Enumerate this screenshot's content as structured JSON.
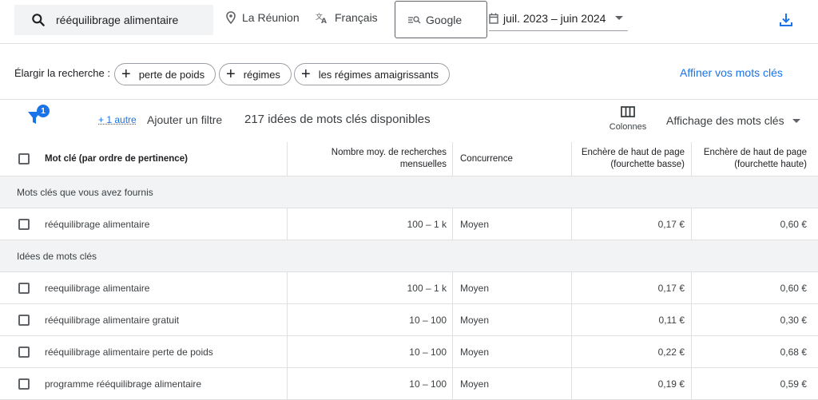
{
  "search": {
    "query": "rééquilibrage alimentaire",
    "location": "La Réunion",
    "language": "Français",
    "network": "Google",
    "date_range": "juil. 2023 – juin 2024"
  },
  "broaden": {
    "label": "Élargir la recherche :",
    "chips": [
      "perte de poids",
      "régimes",
      "les régimes amaigrissants"
    ],
    "refine_link": "Affiner vos mots clés"
  },
  "filters": {
    "badge_count": "1",
    "other_link": "+ 1 autre",
    "add_filter": "Ajouter un filtre",
    "idea_count": "217 idées de mots clés disponibles",
    "columns_label": "Colonnes",
    "view_select": "Affichage des mots clés"
  },
  "table": {
    "headers": {
      "keyword": "Mot clé (par ordre de pertinence)",
      "searches": "Nombre moy. de recherches mensuelles",
      "competition": "Concurrence",
      "bid_low": "Enchère de haut de page (fourchette basse)",
      "bid_high": "Enchère de haut de page (fourchette haute)"
    },
    "sections": [
      {
        "label": "Mots clés que vous avez fournis",
        "rows": [
          {
            "keyword": "rééquilibrage alimentaire",
            "searches": "100 – 1 k",
            "competition": "Moyen",
            "bid_low": "0,17 €",
            "bid_high": "0,60 €"
          }
        ]
      },
      {
        "label": "Idées de mots clés",
        "rows": [
          {
            "keyword": "reequilibrage alimentaire",
            "searches": "100 – 1 k",
            "competition": "Moyen",
            "bid_low": "0,17 €",
            "bid_high": "0,60 €"
          },
          {
            "keyword": "rééquilibrage alimentaire gratuit",
            "searches": "10 – 100",
            "competition": "Moyen",
            "bid_low": "0,11 €",
            "bid_high": "0,30 €"
          },
          {
            "keyword": "rééquilibrage alimentaire perte de poids",
            "searches": "10 – 100",
            "competition": "Moyen",
            "bid_low": "0,22 €",
            "bid_high": "0,68 €"
          },
          {
            "keyword": "programme rééquilibrage alimentaire",
            "searches": "10 – 100",
            "competition": "Moyen",
            "bid_low": "0,19 €",
            "bid_high": "0,59 €"
          }
        ]
      }
    ]
  },
  "colors": {
    "accent": "#1a73e8",
    "section_bg": "#f1f3f4",
    "border": "#e0e0e0"
  },
  "icons": [
    "search-icon",
    "location-pin-icon",
    "translate-icon",
    "google-search-icon",
    "calendar-icon",
    "download-icon",
    "filter-icon",
    "columns-icon",
    "add-icon"
  ]
}
